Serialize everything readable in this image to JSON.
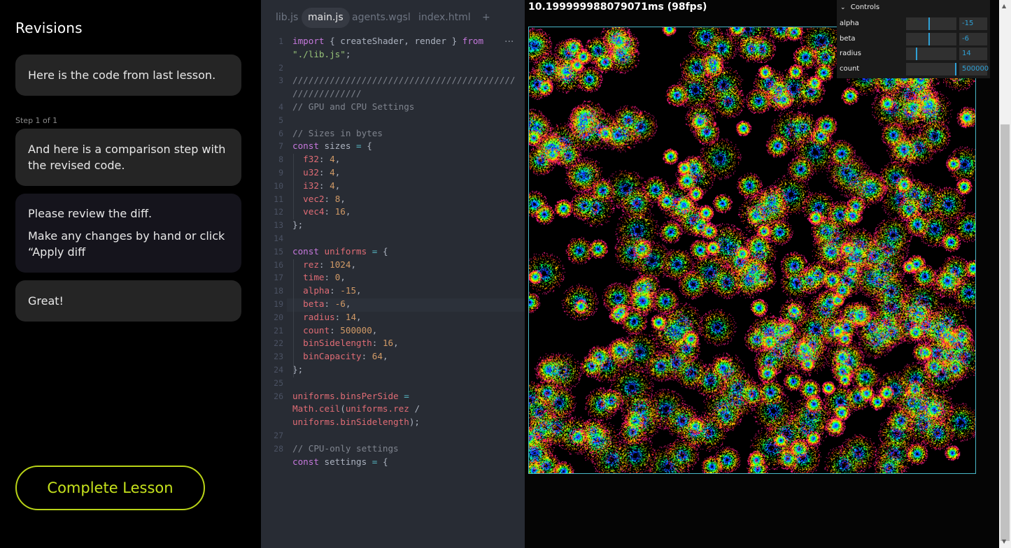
{
  "sidebar": {
    "title": "Revisions",
    "step_label": "Step 1 of 1",
    "messages": [
      {
        "text": "Here is the code from last lesson."
      },
      {
        "text": "And here is a comparison step with the revised code."
      },
      {
        "line1": "Please review the diff.",
        "line2": "Make any changes by hand or click “Apply diff"
      },
      {
        "text": "Great!"
      }
    ],
    "complete_label": "Complete Lesson"
  },
  "editor": {
    "tabs": [
      "lib.js",
      "main.js",
      "agents.wgsl",
      "index.html",
      "+"
    ],
    "active_tab": "main.js",
    "more_icon": "···",
    "line_numbers": [
      "1",
      "",
      "2",
      "3",
      "",
      "4",
      "5",
      "6",
      "7",
      "8",
      "9",
      "10",
      "11",
      "12",
      "13",
      "14",
      "15",
      "16",
      "17",
      "18",
      "19",
      "20",
      "21",
      "22",
      "23",
      "24",
      "25",
      "26",
      "",
      "",
      "27",
      "28"
    ],
    "code_lines": [
      "import { createShader, render } from",
      "\"./lib.js\";",
      "",
      "//////////////////////////////////////////",
      "/////////////",
      "// GPU and CPU Settings",
      "",
      "// Sizes in bytes",
      "const sizes = {",
      "  f32: 4,",
      "  u32: 4,",
      "  i32: 4,",
      "  vec2: 8,",
      "  vec4: 16,",
      "};",
      "",
      "const uniforms = {",
      "  rez: 1024,",
      "  time: 0,",
      "  alpha: -15,",
      "  beta: -6,",
      "  radius: 14,",
      "  count: 500000,",
      "  binSidelength: 16,",
      "  binCapacity: 64,",
      "};",
      "",
      "uniforms.binsPerSide =",
      "Math.ceil(uniforms.rez /",
      "uniforms.binSidelength);",
      "",
      "// CPU-only settings",
      "const settings = {"
    ]
  },
  "viewer": {
    "fps_text": "10.199999988079071ms (98fps)",
    "controls": {
      "title": "Controls",
      "chevron_icon": "chevron-down-icon",
      "rows": [
        {
          "label": "alpha",
          "value": "-15",
          "fraction": 0.45
        },
        {
          "label": "beta",
          "value": "-6",
          "fraction": 0.45
        },
        {
          "label": "radius",
          "value": "14",
          "fraction": 0.2
        },
        {
          "label": "count",
          "value": "500000",
          "fraction": 1.0
        }
      ]
    }
  },
  "colors": {
    "accent": "#c6e21c",
    "control_accent": "#2fa1d6",
    "editor_bg": "#282c34"
  }
}
